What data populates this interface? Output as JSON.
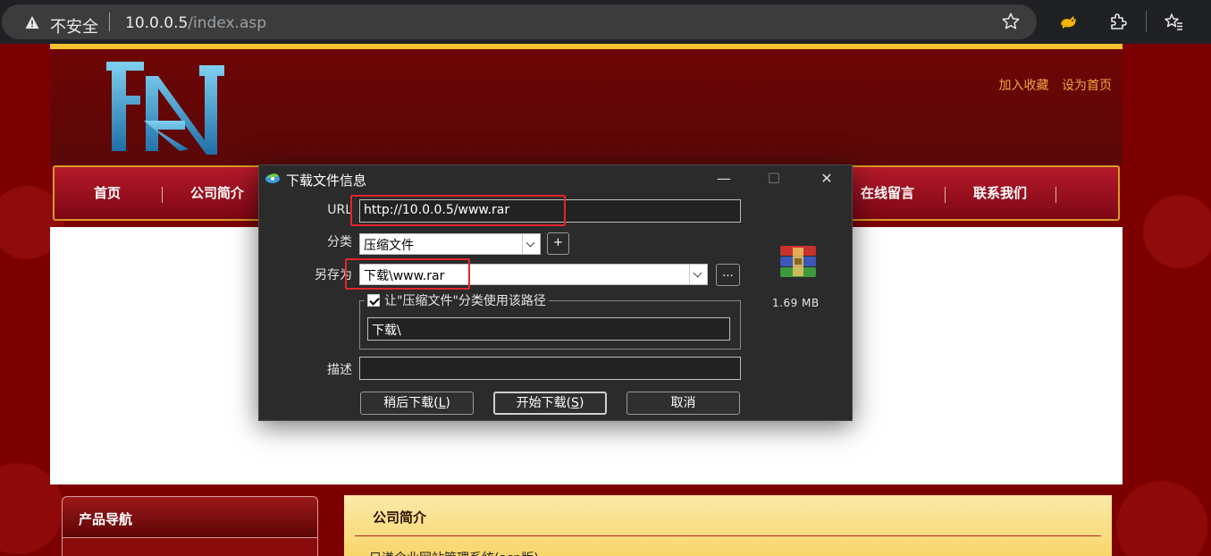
{
  "browser": {
    "insecure_label": "不安全",
    "url_host": "10.0.0.5",
    "url_path": "/index.asp"
  },
  "site": {
    "toplinks": [
      "加入收藏",
      "设为首页"
    ],
    "nav": [
      "首页",
      "公司简介",
      "在线留言",
      "联系我们"
    ],
    "sidebar_title": "产品导航",
    "panel_title": "公司简介",
    "panel_text": "只谦企业网站管理系统(asp版)"
  },
  "dialog": {
    "title": "下载文件信息",
    "url_label": "URL",
    "url_value": "http://10.0.0.5/www.rar",
    "category_label": "分类",
    "category_value": "压缩文件",
    "add_label": "+",
    "saveas_label": "另存为",
    "saveas_value": "下载\\www.rar",
    "browse_label": "...",
    "checkbox_label": "让\"压缩文件\"分类使用该路径",
    "path_value": "下载\\",
    "desc_label": "描述",
    "desc_value": "",
    "later_label": "稍后下载(",
    "later_key": "L",
    "start_label": "开始下载(",
    "start_key": "S",
    "cancel_label": "取消",
    "close_paren": ")",
    "file_size": "1.69  MB",
    "minimize": "—",
    "maximize": "☐",
    "close": "✕",
    "highlight_color": "#e3262a"
  }
}
